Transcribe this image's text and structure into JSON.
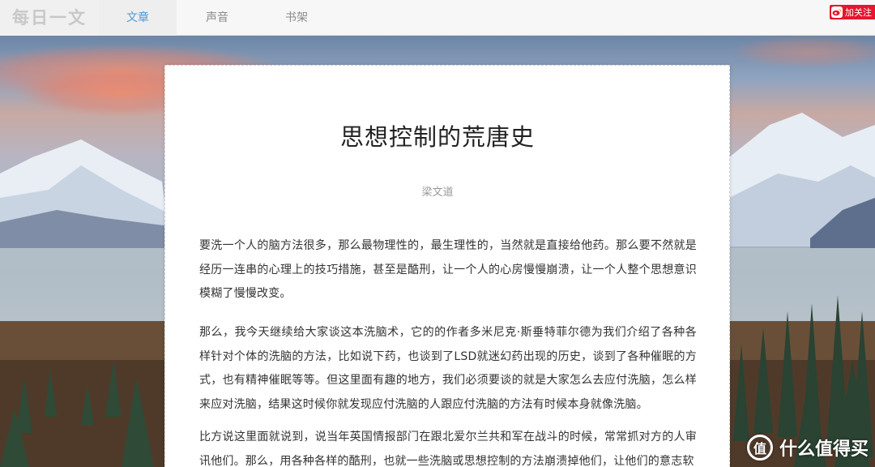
{
  "header": {
    "logo": "每日一文",
    "tabs": [
      {
        "label": "文章",
        "active": true
      },
      {
        "label": "声音",
        "active": false
      },
      {
        "label": "书架",
        "active": false
      }
    ],
    "follow_label": "加关注",
    "follow_icon": "weibo-icon"
  },
  "article": {
    "title": "思想控制的荒唐史",
    "author": "梁文道",
    "paragraphs": [
      "要洗一个人的脑方法很多，那么最物理性的，最生理性的，当然就是直接给他药。那么要不然就是经历一连串的心理上的技巧措施，甚至是酷刑，让一个人的心房慢慢崩溃，让一个人整个思想意识模糊了慢慢改变。",
      "那么，我今天继续给大家谈这本洗脑术，它的的作者多米尼克·斯垂特菲尔德为我们介绍了各种各样针对个体的洗脑的方法，比如说下药，也谈到了LSD就迷幻药出现的历史，谈到了各种催眠的方式，也有精神催眠等等。但这里面有趣的地方，我们必须要谈的就是大家怎么去应付洗脑，怎么样来应对洗脑，结果这时候你就发现应付洗脑的人跟应付洗脑的方法有时候本身就像洗脑。",
      "比方说这里面就说到，说当年英国情报部门在跟北爱尔兰共和军在战斗的时候，常常抓对方的人审讯他们。那么，用各种各样的酷刑，也就一些洗脑或思想控制的方法崩溃掉他们，让他们的意志软"
    ]
  },
  "watermark": {
    "icon_glyph": "值",
    "text": "什么值得买"
  },
  "colors": {
    "accent": "#4a9bd8",
    "weibo_red": "#e6162d"
  }
}
